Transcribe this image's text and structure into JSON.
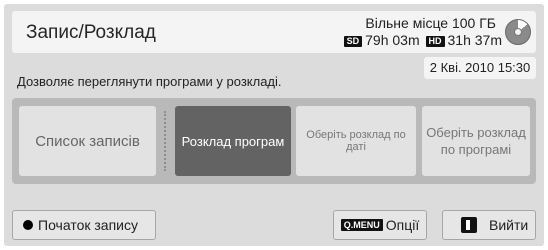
{
  "header": {
    "title": "Запис/Розклад",
    "free_space": "Вільне місце 100 ГБ",
    "sd_badge": "SD",
    "sd_time": "79h 03m",
    "hd_badge": "HD",
    "hd_time": "31h 37m",
    "disk_icon": "disk-usage-icon"
  },
  "datetime": "2 Кві. 2010 15:30",
  "description": "Дозволяє переглянути програми у розкладі.",
  "options": [
    {
      "label": "Список записів",
      "selected": false
    },
    {
      "label": "Розклад програм",
      "selected": true
    },
    {
      "label": "Оберіть розклад по даті",
      "selected": false
    },
    {
      "label": "Оберіть розклад по програмі",
      "selected": false
    }
  ],
  "footer": {
    "start_label": "Початок запису",
    "qmenu_badge": "Q.MENU",
    "options_label": "Опції",
    "exit_label": "Вийти"
  }
}
